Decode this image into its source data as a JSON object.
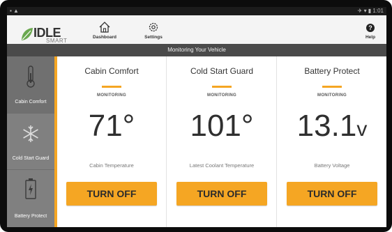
{
  "statusbar": {
    "left_icons": "▪ ▲",
    "right_text": "✈ ▾ ▮ 1:01"
  },
  "logo": {
    "brand": "IDLE",
    "sub": "SMART"
  },
  "nav": {
    "dashboard_label": "Dashboard",
    "settings_label": "Settings",
    "help_label": "Help",
    "help_glyph": "?"
  },
  "banner": {
    "text": "Monitoring Your Vehicle"
  },
  "sidebar": {
    "items": [
      {
        "label": "Cabin Comfort",
        "icon": "thermometer-icon"
      },
      {
        "label": "Cold Start Guard",
        "icon": "snowflake-icon"
      },
      {
        "label": "Battery Protect",
        "icon": "battery-icon"
      }
    ]
  },
  "panels": [
    {
      "title": "Cabin Comfort",
      "status": "MONITORING",
      "value": "71°",
      "unit": "",
      "metric": "Cabin Temperature",
      "button": "TURN OFF"
    },
    {
      "title": "Cold Start Guard",
      "status": "MONITORING",
      "value": "101°",
      "unit": "",
      "metric": "Latest Coolant Temperature",
      "button": "TURN OFF"
    },
    {
      "title": "Battery Protect",
      "status": "MONITORING",
      "value": "13.1",
      "unit": "v",
      "metric": "Battery Voltage",
      "button": "TURN OFF"
    }
  ],
  "colors": {
    "accent": "#f5a623",
    "banner": "#4a4a4a",
    "sidebar": "#808080",
    "logo_green": "#6aa84f"
  }
}
